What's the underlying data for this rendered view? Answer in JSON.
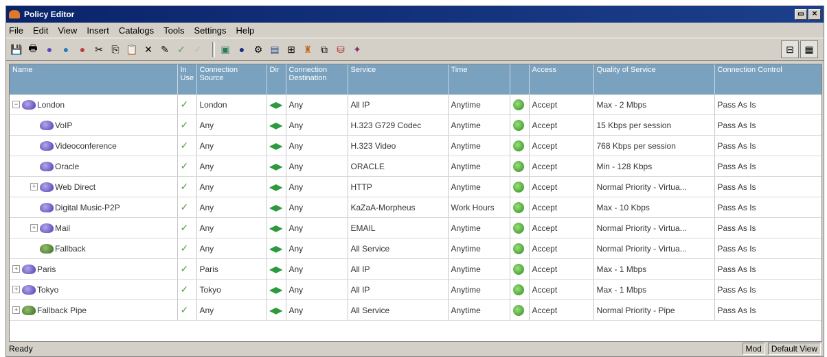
{
  "window": {
    "title": "Policy Editor"
  },
  "menu": [
    "File",
    "Edit",
    "View",
    "Insert",
    "Catalogs",
    "Tools",
    "Settings",
    "Help"
  ],
  "columns": [
    "Name",
    "In Use",
    "Connection Source",
    "Dir",
    "Connection Destination",
    "Service",
    "Time",
    "",
    "Access",
    "Quality of Service",
    "Connection Control"
  ],
  "rows": [
    {
      "name": "London",
      "expand": "minus",
      "indent": 0,
      "source": "London",
      "dest": "Any",
      "service": "All IP",
      "time": "Anytime",
      "access": "Accept",
      "qos": "Max - 2 Mbps",
      "control": "Pass As Is"
    },
    {
      "name": "VoIP",
      "expand": "none",
      "indent": 1,
      "source": "Any",
      "dest": "Any",
      "service": "H.323 G729 Codec",
      "time": "Anytime",
      "access": "Accept",
      "qos": "15 Kbps per session",
      "control": "Pass As Is"
    },
    {
      "name": "Videoconference",
      "expand": "none",
      "indent": 1,
      "source": "Any",
      "dest": "Any",
      "service": "H.323 Video",
      "time": "Anytime",
      "access": "Accept",
      "qos": "768 Kbps per session",
      "control": "Pass As Is"
    },
    {
      "name": "Oracle",
      "expand": "none",
      "indent": 1,
      "source": "Any",
      "dest": "Any",
      "service": "ORACLE",
      "time": "Anytime",
      "access": "Accept",
      "qos": "Min - 128 Kbps",
      "control": "Pass As Is"
    },
    {
      "name": "Web Direct",
      "expand": "plus",
      "indent": 1,
      "source": "Any",
      "dest": "Any",
      "service": "HTTP",
      "time": "Anytime",
      "access": "Accept",
      "qos": "Normal Priority - Virtua...",
      "control": "Pass As Is"
    },
    {
      "name": "Digital Music-P2P",
      "expand": "none",
      "indent": 1,
      "source": "Any",
      "dest": "Any",
      "service": "KaZaA-Morpheus",
      "time": "Work Hours",
      "access": "Accept",
      "qos": "Max - 10 Kbps",
      "control": "Pass As Is"
    },
    {
      "name": "Mail",
      "expand": "plus",
      "indent": 1,
      "source": "Any",
      "dest": "Any",
      "service": "EMAIL",
      "time": "Anytime",
      "access": "Accept",
      "qos": "Normal Priority - Virtua...",
      "control": "Pass As Is"
    },
    {
      "name": "Fallback",
      "expand": "none",
      "indent": 1,
      "fallback": true,
      "source": "Any",
      "dest": "Any",
      "service": "All Service",
      "time": "Anytime",
      "access": "Accept",
      "qos": "Normal Priority - Virtua...",
      "control": "Pass As Is"
    },
    {
      "name": "Paris",
      "expand": "plus",
      "indent": 0,
      "source": "Paris",
      "dest": "Any",
      "service": "All IP",
      "time": "Anytime",
      "access": "Accept",
      "qos": "Max - 1 Mbps",
      "control": "Pass As Is"
    },
    {
      "name": "Tokyo",
      "expand": "plus",
      "indent": 0,
      "source": "Tokyo",
      "dest": "Any",
      "service": "All IP",
      "time": "Anytime",
      "access": "Accept",
      "qos": "Max - 1 Mbps",
      "control": "Pass As Is"
    },
    {
      "name": "Fallback Pipe",
      "expand": "plus",
      "indent": 0,
      "fallback": true,
      "source": "Any",
      "dest": "Any",
      "service": "All Service",
      "time": "Anytime",
      "access": "Accept",
      "qos": "Normal Priority - Pipe",
      "control": "Pass As Is"
    }
  ],
  "status": {
    "text": "Ready",
    "mode": "Mod",
    "view": "Default View"
  }
}
